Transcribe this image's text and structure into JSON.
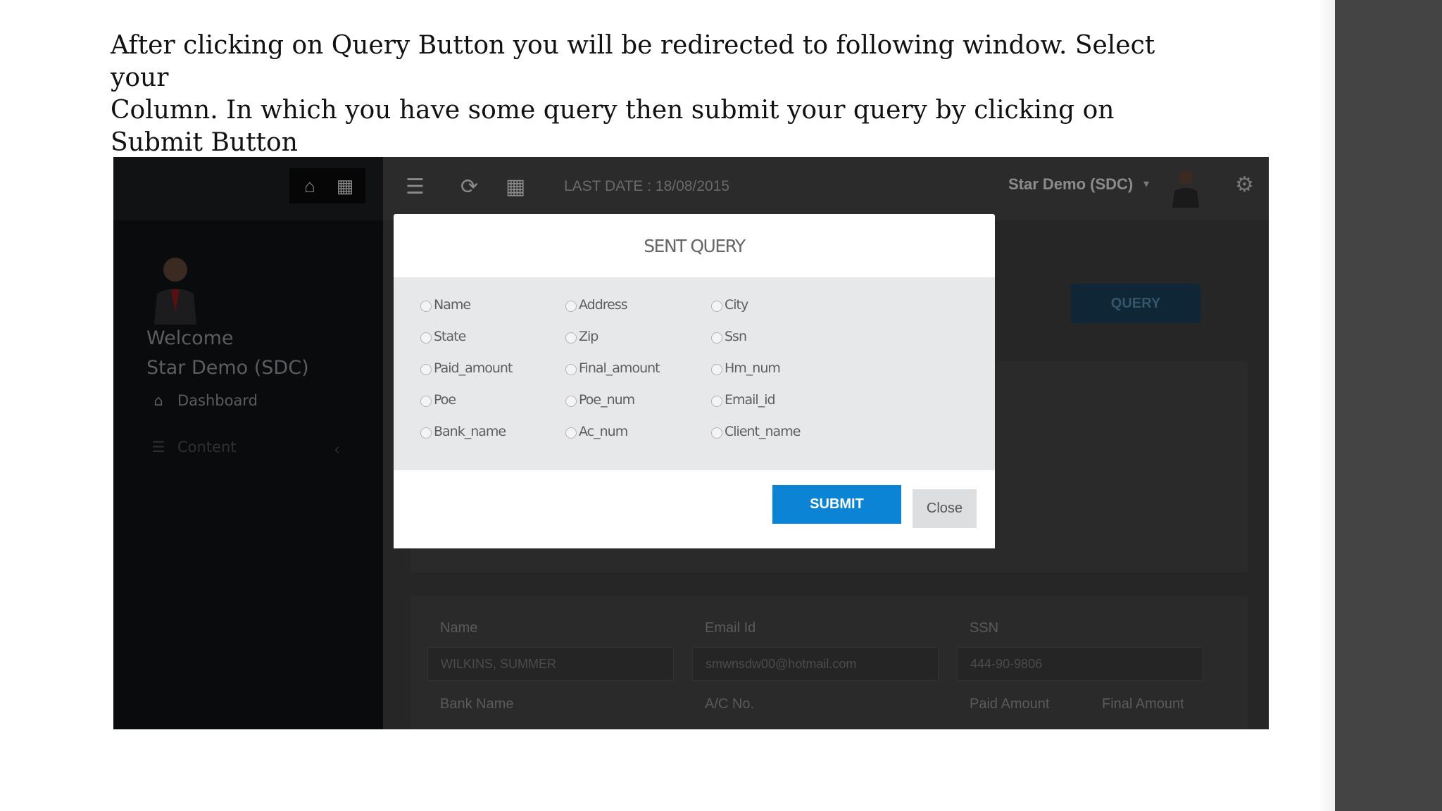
{
  "instruction": {
    "text": "After clicking on Query Button you will be redirected to following window. Select your\nColumn. In which you have some query then submit your query by clicking on\nSubmit Button"
  },
  "app": {
    "sidebar": {
      "welcome_label": "Welcome",
      "user_name": "Star Demo (SDC)",
      "nav": [
        {
          "label": "Dashboard",
          "icon": "home-icon"
        },
        {
          "label": "Content",
          "icon": "list-icon"
        }
      ]
    },
    "topbar": {
      "last_date": "LAST DATE : 18/08/2015",
      "user_name": "Star Demo (SDC)"
    },
    "query_button": "QUERY",
    "form": {
      "labels": {
        "name": "Name",
        "email": "Email Id",
        "ssn": "SSN",
        "bank_name": "Bank Name",
        "ac_no": "A/C No.",
        "paid_amount": "Paid Amount",
        "final_amount": "Final Amount"
      },
      "values": {
        "name": "WILKINS, SUMMER",
        "email": "smwnsdw00@hotmail.com",
        "ssn": "444-90-9806"
      }
    }
  },
  "modal": {
    "title": "SENT QUERY",
    "options": [
      "Name",
      "Address",
      "City",
      "State",
      "Zip",
      "Ssn",
      "Paid_amount",
      "Final_amount",
      "Hm_num",
      "Poe",
      "Poe_num",
      "Email_id",
      "Bank_name",
      "Ac_num",
      "Client_name"
    ],
    "submit_label": "SUBMIT",
    "close_label": "Close"
  },
  "colors": {
    "submit": "#0c84d6",
    "overlay": "#252525",
    "modal_body": "#e6e8ea"
  }
}
